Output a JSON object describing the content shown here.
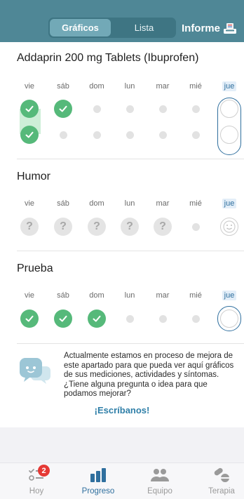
{
  "header": {
    "tabs": [
      {
        "label": "Gráficos",
        "active": true
      },
      {
        "label": "Lista",
        "active": false
      }
    ],
    "report_label": "Informe",
    "report_icon": "report-tray-icon"
  },
  "days": [
    "vie",
    "sáb",
    "dom",
    "lun",
    "mar",
    "mié",
    "jue"
  ],
  "today_index": 6,
  "sections": [
    {
      "title": "Addaprin 200 mg Tablets (Ibuprofen)",
      "rows": [
        [
          "check",
          "check",
          "dot",
          "dot",
          "dot",
          "dot",
          "open"
        ],
        [
          "check",
          "dot",
          "dot",
          "dot",
          "dot",
          "dot",
          "open"
        ]
      ]
    },
    {
      "title": "Humor",
      "rows": [
        [
          "question",
          "question",
          "question",
          "question",
          "question",
          "dot",
          "smiley"
        ]
      ]
    },
    {
      "title": "Prueba",
      "rows": [
        [
          "check",
          "check",
          "check",
          "dot",
          "dot",
          "dot",
          "open"
        ]
      ]
    }
  ],
  "info": {
    "text": "Actualmente estamos en proceso de mejora de este apartado para que pueda ver aquí gráficos de sus mediciones, actividades y síntomas. ¿Tiene alguna pregunta o idea para que podamos mejorar?",
    "link": "¡Escríbanos!"
  },
  "tabbar": {
    "items": [
      {
        "label": "Hoy",
        "icon": "checklist-icon",
        "badge": "2",
        "active": false
      },
      {
        "label": "Progreso",
        "icon": "bar-chart-icon",
        "active": true
      },
      {
        "label": "Equipo",
        "icon": "people-icon",
        "active": false
      },
      {
        "label": "Terapia",
        "icon": "pills-icon",
        "active": false
      }
    ]
  },
  "colors": {
    "header": "#4f8796",
    "accent": "#2f6f9e",
    "check": "#56b97a",
    "badge": "#e53935"
  }
}
